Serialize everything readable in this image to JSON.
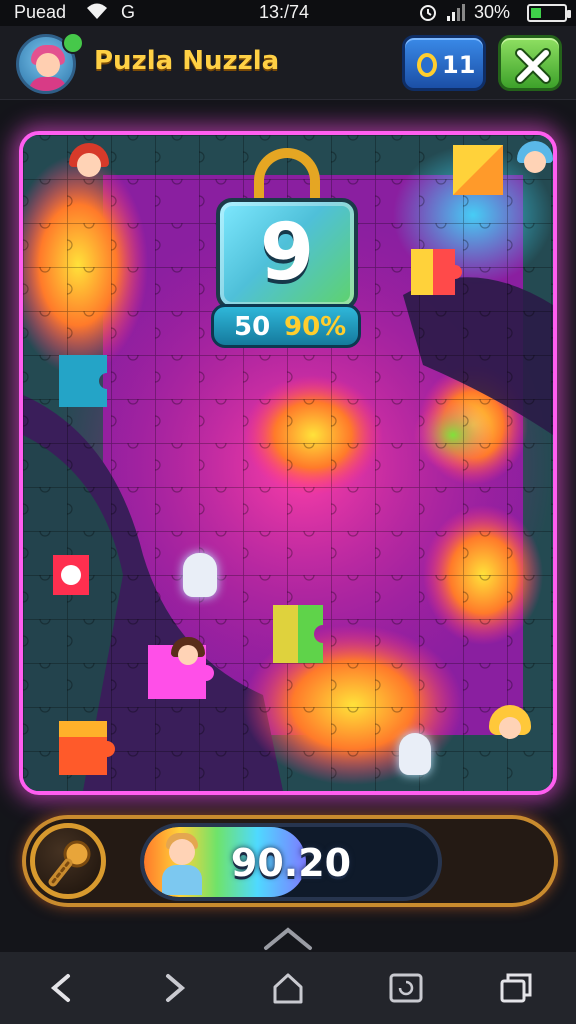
{
  "status_bar": {
    "carrier": "Puead",
    "network": "G",
    "time": "13:/74",
    "battery": "30%",
    "battery_level": 0.3,
    "icons": [
      "wifi-icon",
      "alarm-icon",
      "signal-icon",
      "battery-icon"
    ]
  },
  "header": {
    "title": "Puzla Nuzzla",
    "coins": "0 11",
    "coins_value": "11",
    "close_icon": "close-icon"
  },
  "board": {
    "lock": {
      "number": "9",
      "pill_left": "50",
      "pill_right": "90%"
    },
    "accent_colors": [
      "#ff5ef0",
      "#4fd9ff",
      "#ffd23a"
    ]
  },
  "bottom_bar": {
    "tool_icon": "magnifier-icon",
    "progress_value": "90.20",
    "progress_fraction": 0.55
  },
  "nav_bar": {
    "items": [
      "back-icon",
      "forward-icon",
      "home-icon",
      "tabs-icon",
      "windows-icon"
    ]
  }
}
